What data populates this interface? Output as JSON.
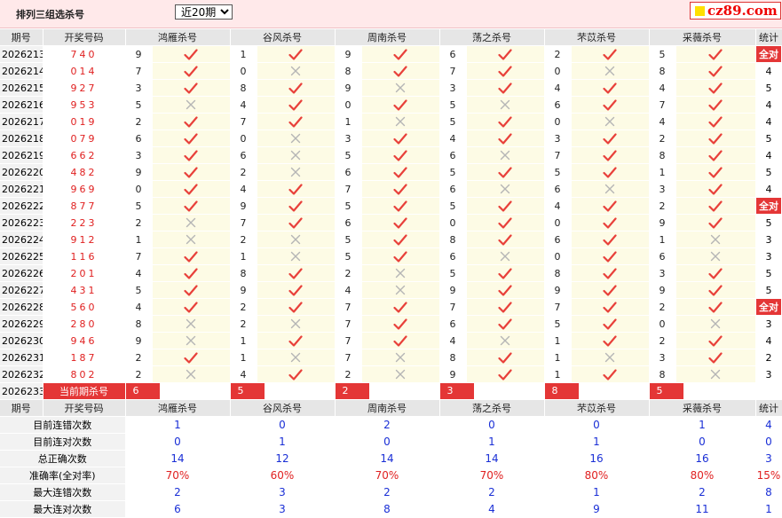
{
  "header": {
    "title": "排列三组选杀号",
    "period_selected": "近20期",
    "period_options": [
      "近20期"
    ],
    "logo_text": "cz89.com"
  },
  "columns": {
    "issue": "期号",
    "draw": "开奖号码",
    "experts": [
      "鸿雁杀号",
      "谷风杀号",
      "周南杀号",
      "荡之杀号",
      "芣苡杀号",
      "采薇杀号"
    ],
    "stats": "统计"
  },
  "badge_text": "全对",
  "rows": [
    {
      "issue": "2026213",
      "draw": "740",
      "k": [
        9,
        1,
        9,
        6,
        2,
        5
      ],
      "ok": [
        1,
        1,
        1,
        1,
        1,
        1
      ],
      "stat": "全对"
    },
    {
      "issue": "2026214",
      "draw": "014",
      "k": [
        7,
        0,
        8,
        7,
        0,
        8
      ],
      "ok": [
        1,
        0,
        1,
        1,
        0,
        1
      ],
      "stat": "4"
    },
    {
      "issue": "2026215",
      "draw": "927",
      "k": [
        3,
        8,
        9,
        3,
        4,
        4
      ],
      "ok": [
        1,
        1,
        0,
        1,
        1,
        1
      ],
      "stat": "5"
    },
    {
      "issue": "2026216",
      "draw": "953",
      "k": [
        5,
        4,
        0,
        5,
        6,
        7
      ],
      "ok": [
        0,
        1,
        1,
        0,
        1,
        1
      ],
      "stat": "4"
    },
    {
      "issue": "2026217",
      "draw": "019",
      "k": [
        2,
        7,
        1,
        5,
        0,
        4
      ],
      "ok": [
        1,
        1,
        0,
        1,
        0,
        1
      ],
      "stat": "4"
    },
    {
      "issue": "2026218",
      "draw": "079",
      "k": [
        6,
        0,
        3,
        4,
        3,
        2
      ],
      "ok": [
        1,
        0,
        1,
        1,
        1,
        1
      ],
      "stat": "5"
    },
    {
      "issue": "2026219",
      "draw": "662",
      "k": [
        3,
        6,
        5,
        6,
        7,
        8
      ],
      "ok": [
        1,
        0,
        1,
        0,
        1,
        1
      ],
      "stat": "4"
    },
    {
      "issue": "2026220",
      "draw": "482",
      "k": [
        9,
        2,
        6,
        5,
        5,
        1
      ],
      "ok": [
        1,
        0,
        1,
        1,
        1,
        1
      ],
      "stat": "5"
    },
    {
      "issue": "2026221",
      "draw": "969",
      "k": [
        0,
        4,
        7,
        6,
        6,
        3
      ],
      "ok": [
        1,
        1,
        1,
        0,
        0,
        1
      ],
      "stat": "4"
    },
    {
      "issue": "2026222",
      "draw": "877",
      "k": [
        5,
        9,
        5,
        5,
        4,
        2
      ],
      "ok": [
        1,
        1,
        1,
        1,
        1,
        1
      ],
      "stat": "全对"
    },
    {
      "issue": "2026223",
      "draw": "223",
      "k": [
        2,
        7,
        6,
        0,
        0,
        9
      ],
      "ok": [
        0,
        1,
        1,
        1,
        1,
        1
      ],
      "stat": "5"
    },
    {
      "issue": "2026224",
      "draw": "912",
      "k": [
        1,
        2,
        5,
        8,
        6,
        1
      ],
      "ok": [
        0,
        0,
        1,
        1,
        1,
        0
      ],
      "stat": "3"
    },
    {
      "issue": "2026225",
      "draw": "116",
      "k": [
        7,
        1,
        5,
        6,
        0,
        6
      ],
      "ok": [
        1,
        0,
        1,
        0,
        1,
        0
      ],
      "stat": "3"
    },
    {
      "issue": "2026226",
      "draw": "201",
      "k": [
        4,
        8,
        2,
        5,
        8,
        3
      ],
      "ok": [
        1,
        1,
        0,
        1,
        1,
        1
      ],
      "stat": "5"
    },
    {
      "issue": "2026227",
      "draw": "431",
      "k": [
        5,
        9,
        4,
        9,
        9,
        9
      ],
      "ok": [
        1,
        1,
        0,
        1,
        1,
        1
      ],
      "stat": "5"
    },
    {
      "issue": "2026228",
      "draw": "560",
      "k": [
        4,
        2,
        7,
        7,
        7,
        2
      ],
      "ok": [
        1,
        1,
        1,
        1,
        1,
        1
      ],
      "stat": "全对"
    },
    {
      "issue": "2026229",
      "draw": "280",
      "k": [
        8,
        2,
        7,
        6,
        5,
        0
      ],
      "ok": [
        0,
        0,
        1,
        1,
        1,
        0
      ],
      "stat": "3"
    },
    {
      "issue": "2026230",
      "draw": "946",
      "k": [
        9,
        1,
        7,
        4,
        1,
        2
      ],
      "ok": [
        0,
        1,
        1,
        0,
        1,
        1
      ],
      "stat": "4"
    },
    {
      "issue": "2026231",
      "draw": "187",
      "k": [
        2,
        1,
        7,
        8,
        1,
        3
      ],
      "ok": [
        1,
        0,
        0,
        1,
        0,
        1
      ],
      "stat": "2"
    },
    {
      "issue": "2026232",
      "draw": "802",
      "k": [
        2,
        4,
        2,
        9,
        1,
        8
      ],
      "ok": [
        0,
        1,
        0,
        1,
        1,
        0
      ],
      "stat": "3"
    }
  ],
  "current": {
    "issue": "2026233",
    "label": "当前期杀号",
    "k": [
      6,
      5,
      2,
      3,
      8,
      5
    ]
  },
  "summary": [
    {
      "label": "目前连错次数",
      "values": [
        "1",
        "0",
        "2",
        "0",
        "0",
        "1"
      ],
      "stat": "4",
      "color": "blue"
    },
    {
      "label": "目前连对次数",
      "values": [
        "0",
        "1",
        "0",
        "1",
        "1",
        "0"
      ],
      "stat": "0",
      "color": "blue"
    },
    {
      "label": "总正确次数",
      "values": [
        "14",
        "12",
        "14",
        "14",
        "16",
        "16"
      ],
      "stat": "3",
      "color": "blue"
    },
    {
      "label": "准确率(全对率)",
      "values": [
        "70%",
        "60%",
        "70%",
        "70%",
        "80%",
        "80%"
      ],
      "stat": "15%",
      "color": "red"
    },
    {
      "label": "最大连错次数",
      "values": [
        "2",
        "3",
        "2",
        "2",
        "1",
        "2"
      ],
      "stat": "8",
      "color": "blue"
    },
    {
      "label": "最大连对次数",
      "values": [
        "6",
        "3",
        "8",
        "4",
        "9",
        "11"
      ],
      "stat": "1",
      "color": "blue"
    }
  ],
  "colors": {
    "check": "#e8403a",
    "cross": "#b5b5b5",
    "accent": "#e43636",
    "blue": "#1a2fd6"
  }
}
